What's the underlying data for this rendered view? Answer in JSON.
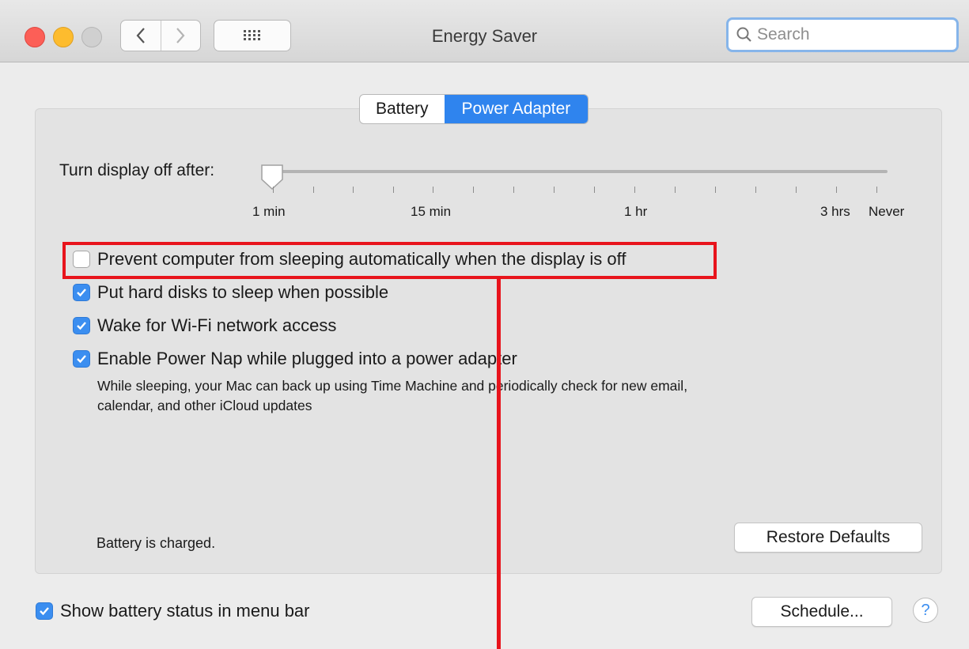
{
  "window": {
    "title": "Energy Saver"
  },
  "toolbar": {
    "search_placeholder": "Search"
  },
  "tabs": [
    {
      "label": "Battery",
      "active": false
    },
    {
      "label": "Power Adapter",
      "active": true
    }
  ],
  "display_sleep": {
    "label": "Turn display off after:",
    "value": "1 min",
    "tick_labels": [
      "1 min",
      "15 min",
      "1 hr",
      "3 hrs",
      "Never"
    ]
  },
  "options": [
    {
      "label": "Prevent computer from sleeping automatically when the display is off",
      "checked": false
    },
    {
      "label": "Put hard disks to sleep when possible",
      "checked": true
    },
    {
      "label": "Wake for Wi-Fi network access",
      "checked": true
    },
    {
      "label": "Enable Power Nap while plugged into a power adapter",
      "checked": true
    }
  ],
  "power_nap_description_line1": "While sleeping, your Mac can back up using Time Machine and periodically check for new email,",
  "power_nap_description_line2": "calendar, and other iCloud updates",
  "status_text": "Battery is charged.",
  "restore_defaults_label": "Restore Defaults",
  "show_battery_status": {
    "label": "Show battery status in menu bar",
    "checked": true
  },
  "schedule_label": "Schedule...",
  "help_label": "?",
  "colors": {
    "accent": "#3b8ef0",
    "highlight": "#e8141c"
  }
}
